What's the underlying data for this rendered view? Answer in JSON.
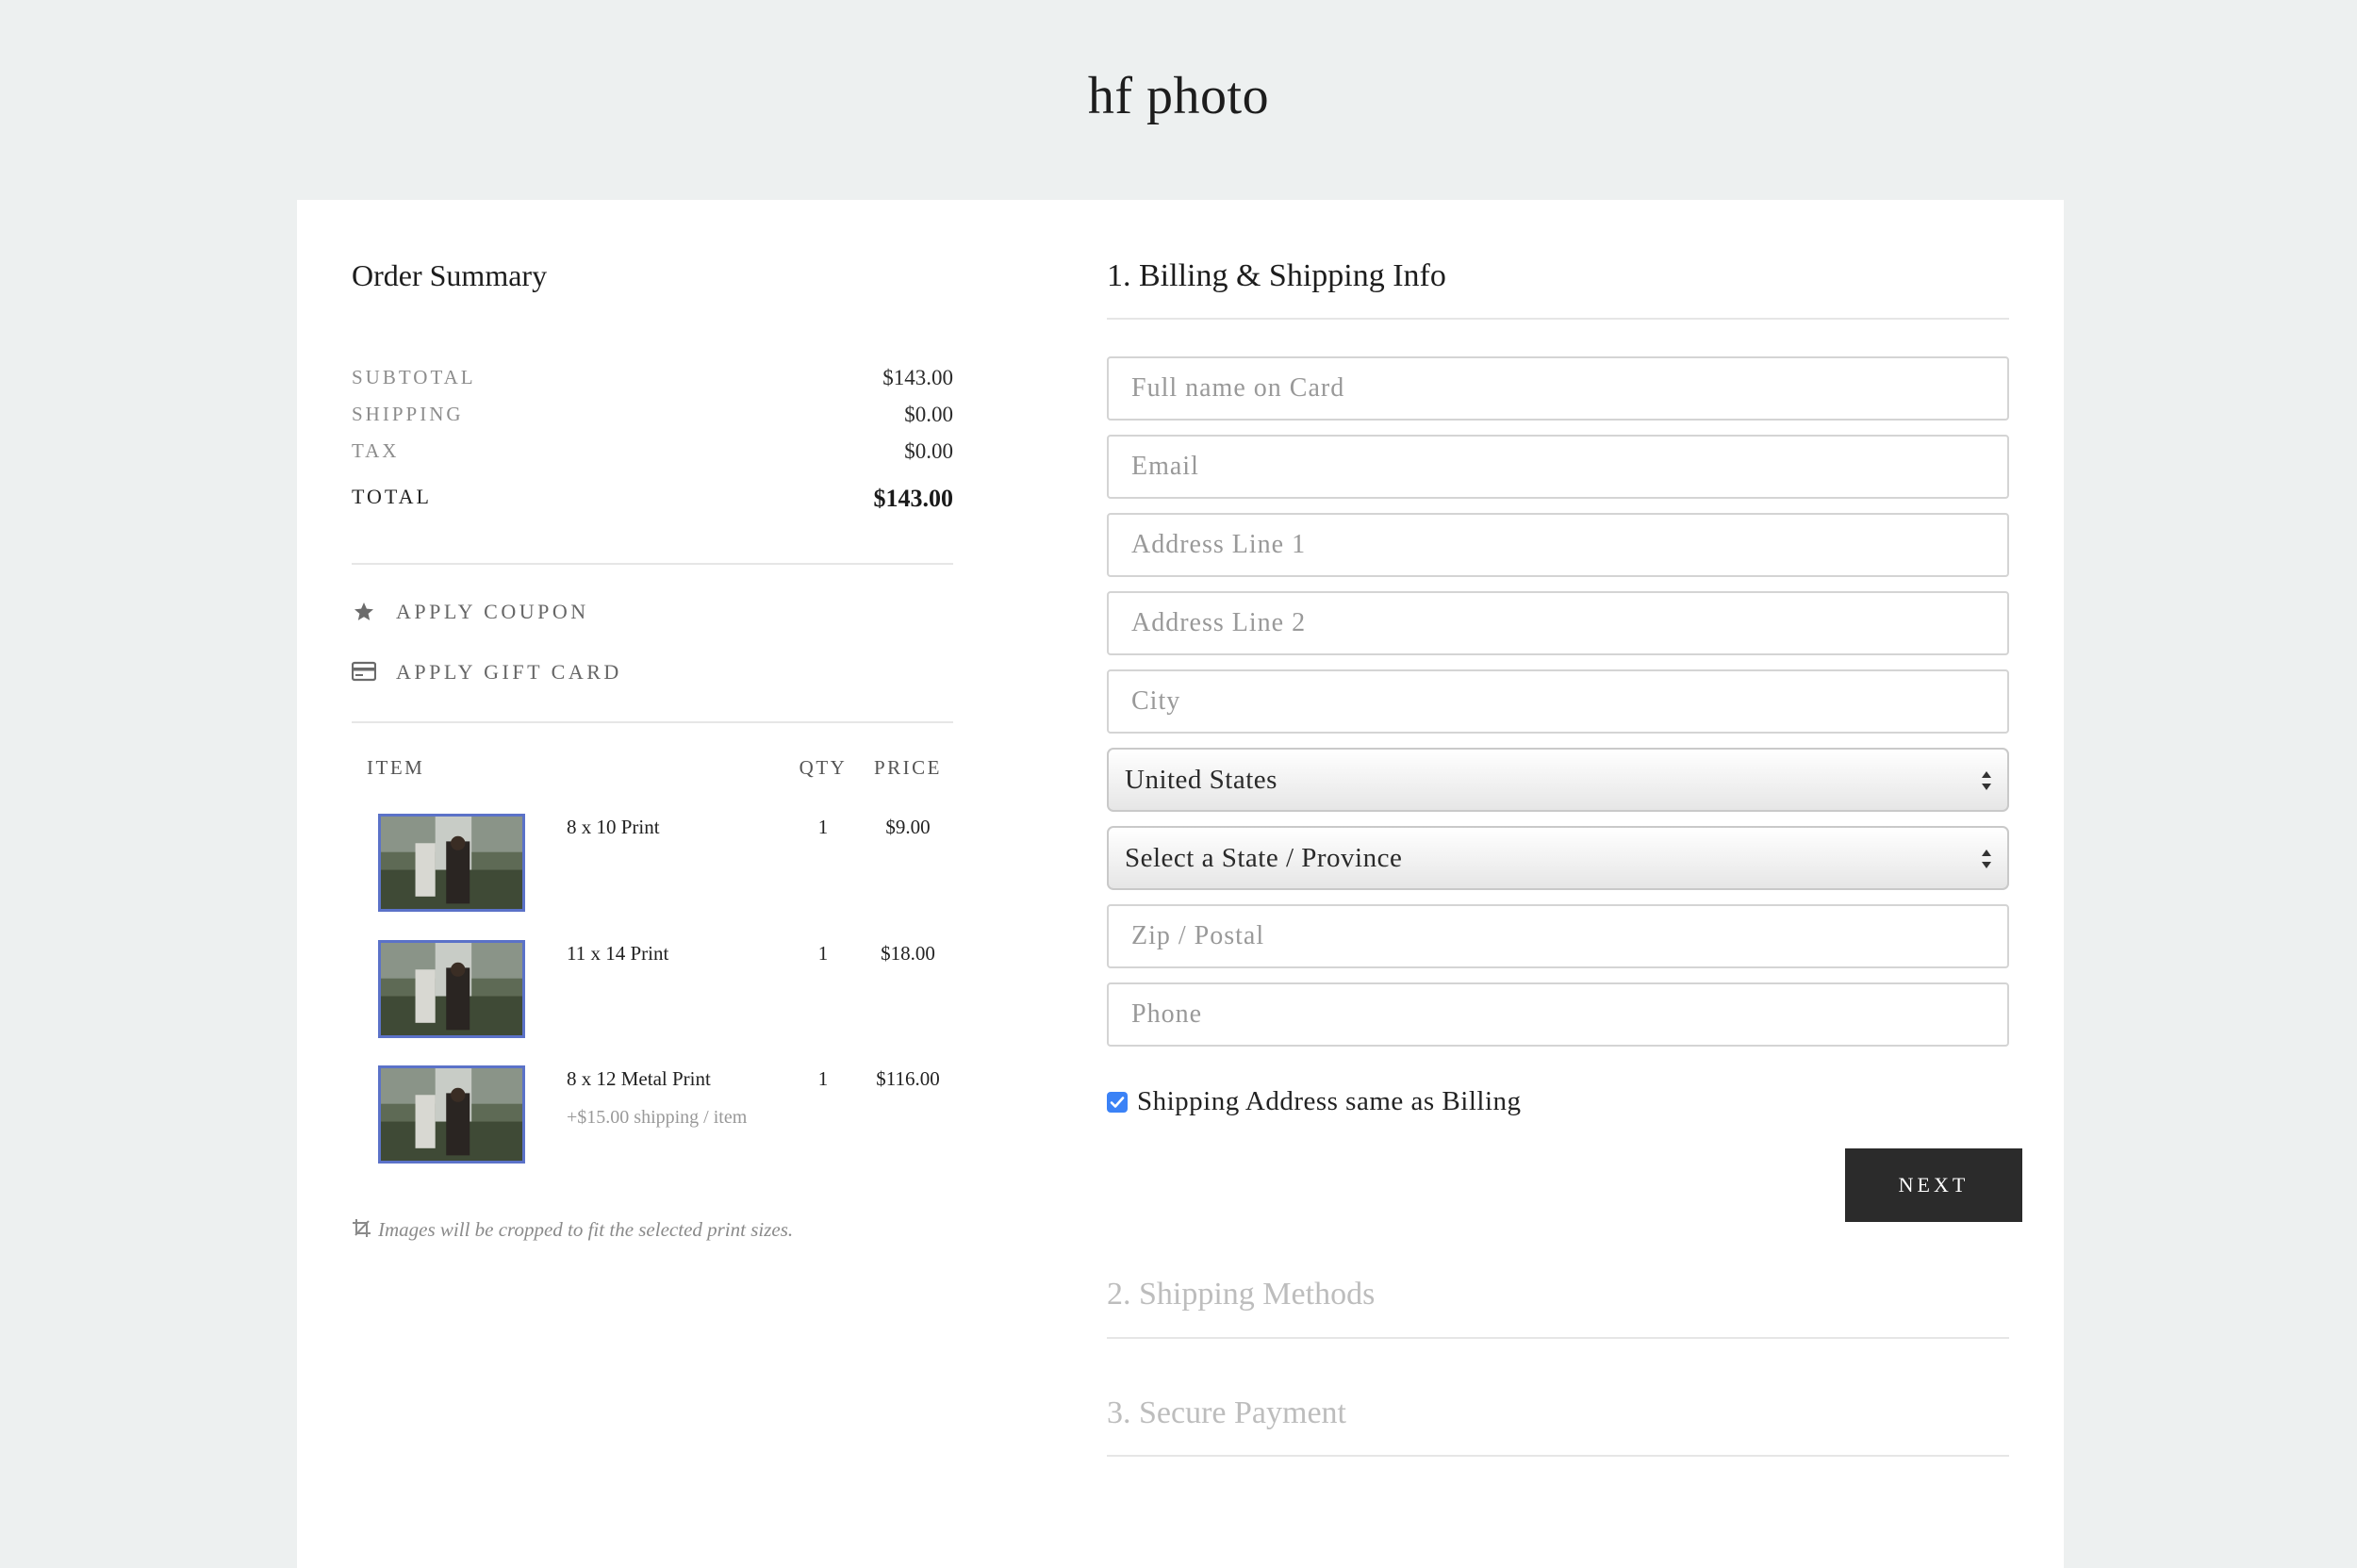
{
  "brand": {
    "name": "hf photo"
  },
  "order_summary": {
    "title": "Order Summary",
    "rows": [
      {
        "label": "SUBTOTAL",
        "value": "$143.00"
      },
      {
        "label": "SHIPPING",
        "value": "$0.00"
      },
      {
        "label": "TAX",
        "value": "$0.00"
      }
    ],
    "total": {
      "label": "TOTAL",
      "value": "$143.00"
    },
    "actions": {
      "coupon": "APPLY COUPON",
      "gift_card": "APPLY GIFT CARD"
    },
    "table": {
      "headers": {
        "item": "ITEM",
        "qty": "QTY",
        "price": "PRICE"
      },
      "items": [
        {
          "name": "8 x 10 Print",
          "qty": "1",
          "price": "$9.00",
          "note": ""
        },
        {
          "name": "11 x 14 Print",
          "qty": "1",
          "price": "$18.00",
          "note": ""
        },
        {
          "name": "8 x 12 Metal Print",
          "qty": "1",
          "price": "$116.00",
          "note": "+$15.00 shipping / item"
        }
      ]
    },
    "crop_note": "Images will be cropped to fit the selected print sizes."
  },
  "billing": {
    "title": "1. Billing & Shipping Info",
    "fields": {
      "full_name": "Full name on Card",
      "email": "Email",
      "address1": "Address Line 1",
      "address2": "Address Line 2",
      "city": "City",
      "zip": "Zip / Postal",
      "phone": "Phone"
    },
    "country": "United States",
    "state": "Select a State / Province",
    "same_address": "Shipping Address same as Billing",
    "next": "NEXT"
  },
  "steps": {
    "shipping": "2. Shipping Methods",
    "payment": "3. Secure Payment"
  },
  "colors": {
    "background": "#edf0f0",
    "button": "#2b2b2b",
    "thumb_border": "#5b72c8",
    "checkbox": "#3b82f6"
  }
}
